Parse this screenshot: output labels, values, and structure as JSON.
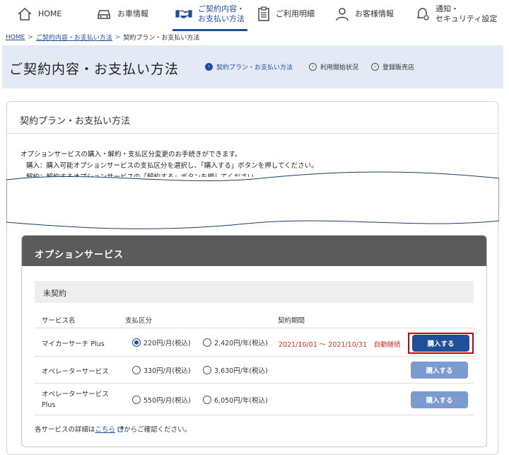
{
  "nav": {
    "home": "HOME",
    "car": "お車情報",
    "contract": "ご契約内容・\nお支払い方法",
    "usage": "ご利用明細",
    "customer": "お客様情報",
    "notify": "通知・\nセキュリティ設定"
  },
  "breadcrumb": {
    "home": "HOME",
    "contract": "ご契約内容・お支払い方法",
    "current": "契約プラン・お支払い方法",
    "separator": ">"
  },
  "page_title": "ご契約内容・お支払い方法",
  "subnav": [
    {
      "label": "契約プラン・お支払い方法",
      "active": true
    },
    {
      "label": "利用開始状況",
      "active": false
    },
    {
      "label": "登録販売店",
      "active": false
    }
  ],
  "panel": {
    "title": "契約プラン・お支払い方法",
    "desc1": "オプションサービスの購入・解約・支払区分変更のお手続きができます。",
    "desc2": "購入：購入可能オプションサービスの支払区分を選択し、「購入する」ボタンを押してください。",
    "desc3": "解約：解約するオプションサービスの「解約する」ボタンを押してください。"
  },
  "options": {
    "header": "オプションサービス",
    "group": "未契約",
    "columns": {
      "name": "サービス名",
      "payment": "支払区分",
      "period": "契約期間"
    },
    "rows": [
      {
        "name": "マイカーサーチ Plus",
        "monthly": "220円/月(税込)",
        "yearly": "2,420円/年(税込)",
        "selected": "monthly",
        "period": "2021/10/01 ～ 2021/10/31　自動継続",
        "button": "購入する",
        "enabled": true
      },
      {
        "name": "オペレーターサービス",
        "monthly": "330円/月(税込)",
        "yearly": "3,630円/年(税込)",
        "selected": "",
        "period": "",
        "button": "購入する",
        "enabled": false
      },
      {
        "name": "オペレーターサービス\nPlus",
        "monthly": "550円/月(税込)",
        "yearly": "6,050円/年(税込)",
        "selected": "",
        "period": "",
        "button": "購入する",
        "enabled": false
      }
    ],
    "footer_prefix": "各サービスの詳細は",
    "footer_link": "こちら",
    "footer_suffix": "からご確認ください。"
  },
  "colors": {
    "accent": "#1f4e9c",
    "highlight": "#d40000",
    "period": "#d0342c",
    "header_bg": "#5b5b5b",
    "band_bg": "#e3eaf6"
  },
  "icons": [
    "home-icon",
    "car-icon",
    "handshake-icon",
    "clipboard-icon",
    "person-icon",
    "bell-gear-icon",
    "chevron-circle-icon",
    "external-link-icon"
  ]
}
